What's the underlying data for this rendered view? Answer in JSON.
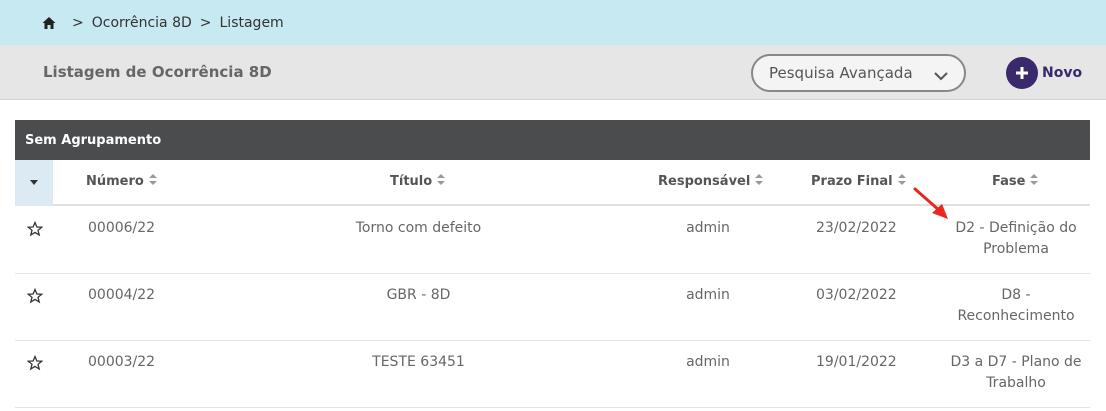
{
  "breadcrumb": {
    "home_icon": "home-icon",
    "items": [
      "Ocorrência 8D",
      "Listagem"
    ],
    "separator": ">"
  },
  "header": {
    "title": "Listagem de Ocorrência 8D",
    "advanced_search_label": "Pesquisa Avançada",
    "new_label": "Novo"
  },
  "group": {
    "label": "Sem Agrupamento"
  },
  "table": {
    "columns": [
      "Número",
      "Título",
      "Responsável",
      "Prazo Final",
      "Fase"
    ],
    "rows": [
      {
        "numero": "00006/22",
        "titulo": "Torno com defeito",
        "responsavel": "admin",
        "prazo": "23/02/2022",
        "fase": "D2 - Definição do Problema"
      },
      {
        "numero": "00004/22",
        "titulo": "GBR - 8D",
        "responsavel": "admin",
        "prazo": "03/02/2022",
        "fase": "D8 - Reconhecimento"
      },
      {
        "numero": "00003/22",
        "titulo": "TESTE 63451",
        "responsavel": "admin",
        "prazo": "19/01/2022",
        "fase": "D3 a D7 - Plano de Trabalho"
      }
    ]
  },
  "colors": {
    "breadcrumb_bg": "#c6e9f2",
    "header_bg": "#e6e6e6",
    "group_bg": "#4a4c4e",
    "accent": "#3b2a6b",
    "arrow": "#e8271e"
  }
}
